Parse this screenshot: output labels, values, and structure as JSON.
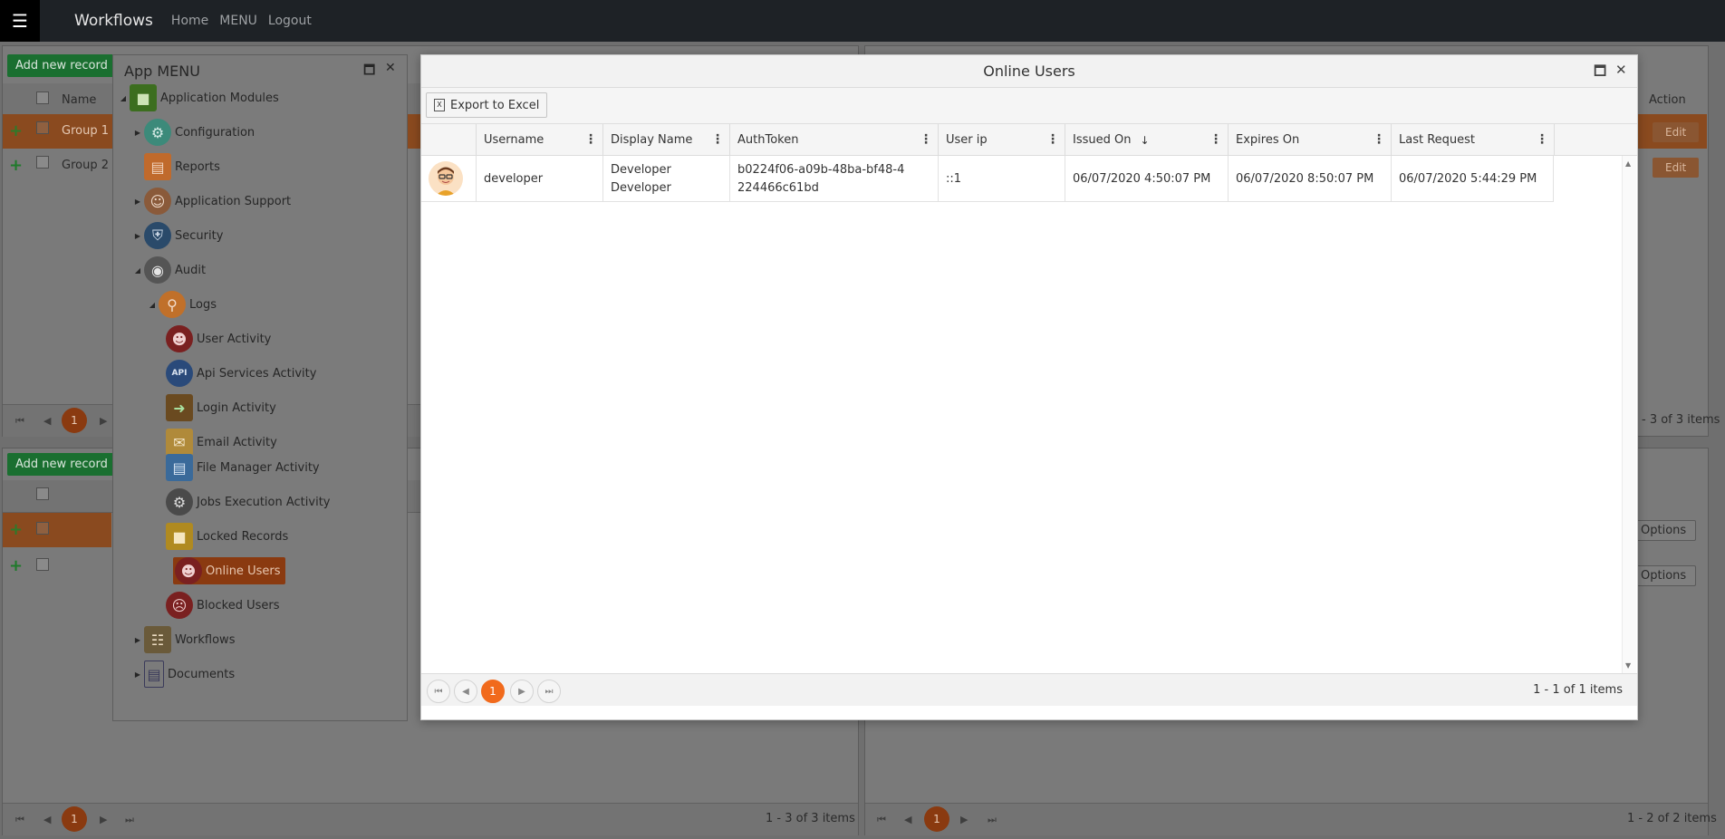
{
  "navbar": {
    "menu_icon": "hamburger-icon",
    "brand": "Workflows",
    "links": [
      "Home",
      "MENU",
      "Logout"
    ]
  },
  "background": {
    "top_left": {
      "add_label": "Add new record",
      "col_name": "Name",
      "rows": [
        "Group 1",
        "Group 2"
      ],
      "page": "1"
    },
    "top_right": {
      "col_action": "Action",
      "edit_label": "Edit",
      "items_info": "1 - 3 of 3 items"
    },
    "bottom_left": {
      "add_label": "Add new record",
      "page": "1",
      "items_info": "1 - 3 of 3 items"
    },
    "bottom_right": {
      "options_label": "Options",
      "page": "1",
      "items_info": "1 - 2 of 2 items"
    }
  },
  "app_menu": {
    "title": "App MENU",
    "tree": [
      {
        "label": "Application Modules",
        "icon": "cube-icon",
        "color": "#3c6e1f"
      },
      {
        "label": "Configuration",
        "icon": "gear-icon",
        "color": "#3c8a7a"
      },
      {
        "label": "Reports",
        "icon": "chart-icon",
        "color": "#c06a2c"
      },
      {
        "label": "Application Support",
        "icon": "support-agent-icon",
        "color": "#8a5a3a"
      },
      {
        "label": "Security",
        "icon": "shield-icon",
        "color": "#2a4a6a"
      },
      {
        "label": "Audit",
        "icon": "eye-icon",
        "color": "#555555"
      },
      {
        "label": "Logs",
        "icon": "magnifier-icon",
        "color": "#c0702a"
      },
      {
        "label": "User Activity",
        "icon": "user-activity-icon",
        "color": "#7a2020"
      },
      {
        "label": "Api Services Activity",
        "icon": "api-icon",
        "color": "#2a4a7a"
      },
      {
        "label": "Login Activity",
        "icon": "login-door-icon",
        "color": "#6a4a20"
      },
      {
        "label": "Email Activity",
        "icon": "envelope-icon",
        "color": "#b08a3a"
      },
      {
        "label": "File Manager Activity",
        "icon": "file-cabinet-icon",
        "color": "#3a6a9a"
      },
      {
        "label": "Jobs Execution Activity",
        "icon": "gears-icon",
        "color": "#4a4a4a"
      },
      {
        "label": "Locked Records",
        "icon": "padlock-icon",
        "color": "#b08a20"
      },
      {
        "label": "Online Users",
        "icon": "online-user-icon",
        "color": "#7a2020"
      },
      {
        "label": "Blocked Users",
        "icon": "blocked-user-icon",
        "color": "#7a2020"
      },
      {
        "label": "Workflows",
        "icon": "workflow-icon",
        "color": "#6a5a3a"
      },
      {
        "label": "Documents",
        "icon": "document-icon",
        "color": "#3a3a5a"
      }
    ]
  },
  "modal": {
    "title": "Online Users",
    "export_label": "Export to Excel",
    "columns": [
      "Username",
      "Display Name",
      "AuthToken",
      "User ip",
      "Issued On",
      "Expires On",
      "Last Request"
    ],
    "rows": [
      {
        "username": "developer",
        "display_name": "Developer Developer",
        "auth_token": "b0224f06-a09b-48ba-bf48-4224466c61bd",
        "user_ip": "::1",
        "issued_on": "06/07/2020 4:50:07 PM",
        "expires_on": "06/07/2020 8:50:07 PM",
        "last_request": "06/07/2020 5:44:29 PM"
      }
    ],
    "pager": {
      "current_page": "1",
      "info": "1 - 1 of 1 items"
    }
  },
  "colors": {
    "accent": "#f16a1c",
    "navbar": "#1e2226",
    "add_button": "#1a6f30"
  }
}
